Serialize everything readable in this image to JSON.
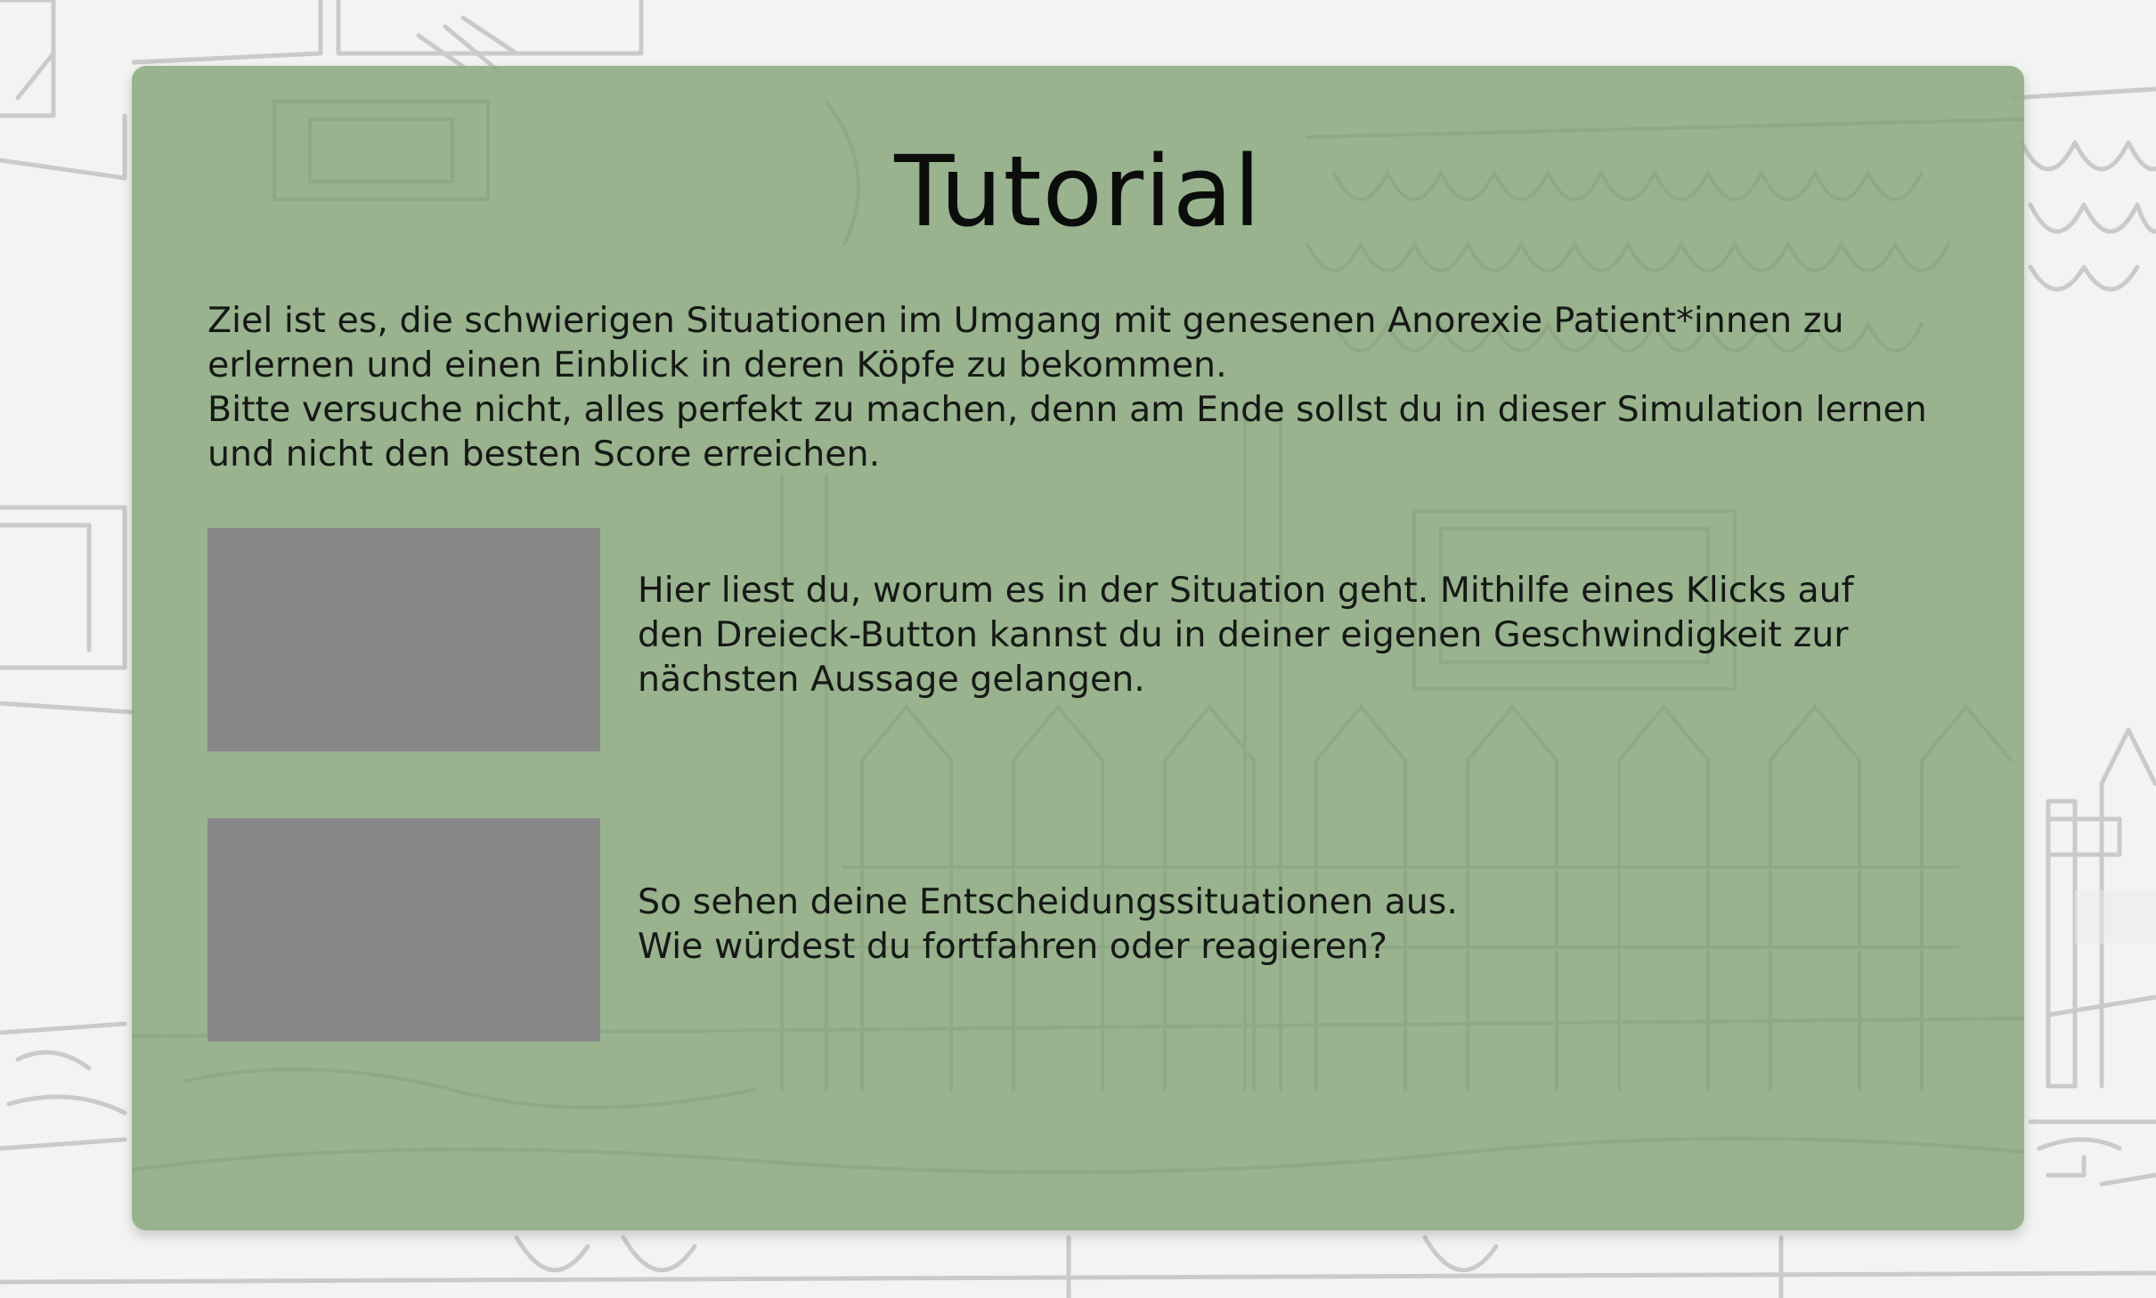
{
  "tutorial": {
    "title": "Tutorial",
    "intro": {
      "line1": "Ziel ist es, die schwierigen Situationen im Umgang mit genesenen Anorexie Patient*innen zu erlernen und einen Einblick in deren Köpfe zu bekommen.",
      "line2": "Bitte versuche nicht, alles perfekt zu machen, denn am Ende sollst du in dieser Simulation lernen und nicht den besten Score erreichen."
    },
    "sections": [
      {
        "text": "Hier liest du, worum es in der Situation geht. Mithilfe eines Klicks auf den Dreieck-Button kannst du in deiner eigenen Geschwindigkeit zur nächsten Aussage gelangen."
      },
      {
        "line1": "So sehen deine Entscheidungssituationen aus.",
        "line2": "Wie würdest du fortfahren oder reagieren?"
      }
    ]
  },
  "colors": {
    "panel": "#8caa80",
    "preview_placeholder": "#888888",
    "text": "#161816"
  }
}
